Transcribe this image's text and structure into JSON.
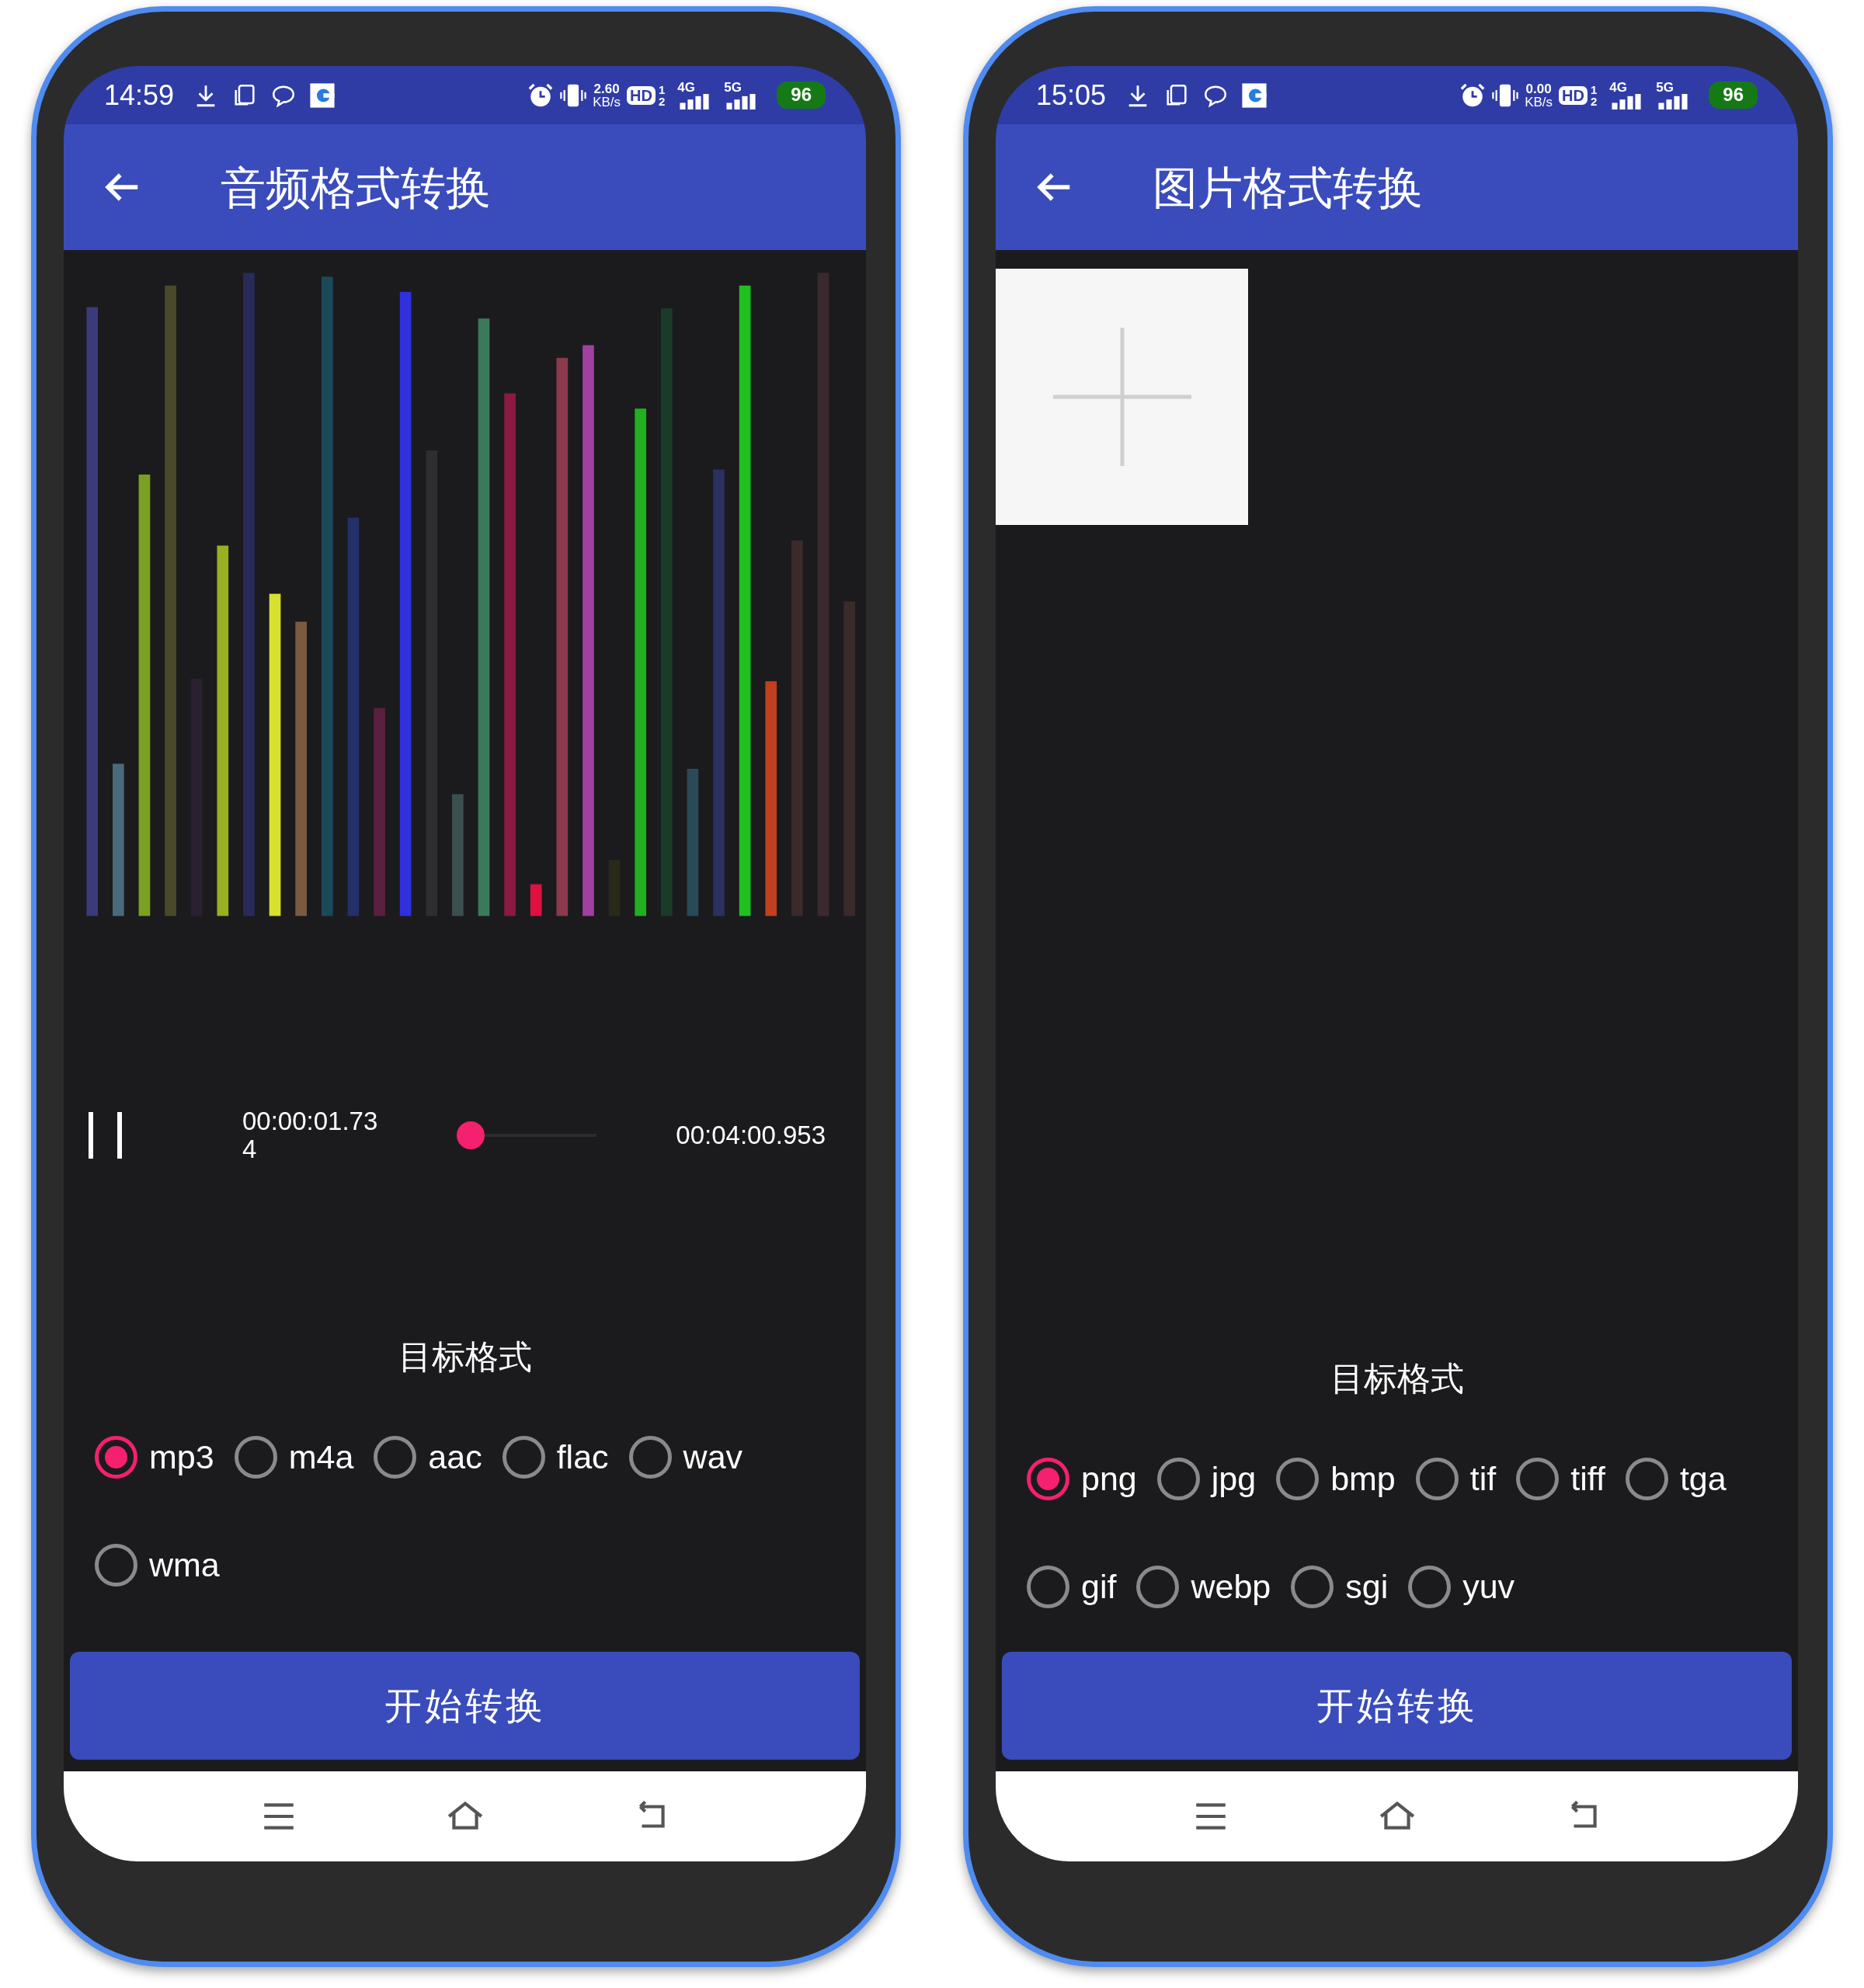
{
  "screens": [
    {
      "status_bar": {
        "time": "14:59",
        "speed_value": "2.60",
        "speed_unit": "KB/s",
        "hd_label": "HD",
        "sim_slots": [
          "1",
          "2"
        ],
        "networks": [
          "4G",
          "5G"
        ],
        "battery": "96"
      },
      "app_bar": {
        "title": "音频格式转换"
      },
      "content": {
        "kind": "audio",
        "player": {
          "playing": true,
          "elapsed": "00:00:01.734",
          "level": 0,
          "duration": "00:04:00.953"
        }
      },
      "format_label": "目标格式",
      "formats": [
        {
          "label": "mp3",
          "selected": true
        },
        {
          "label": "m4a",
          "selected": false
        },
        {
          "label": "aac",
          "selected": false
        },
        {
          "label": "flac",
          "selected": false
        },
        {
          "label": "wav",
          "selected": false
        },
        {
          "label": "wma",
          "selected": false
        }
      ],
      "convert_button": "开始转换"
    },
    {
      "status_bar": {
        "time": "15:05",
        "speed_value": "0.00",
        "speed_unit": "KB/s",
        "hd_label": "HD",
        "sim_slots": [
          "1",
          "2"
        ],
        "networks": [
          "4G",
          "5G"
        ],
        "battery": "96"
      },
      "app_bar": {
        "title": "图片格式转换"
      },
      "content": {
        "kind": "image"
      },
      "format_label": "目标格式",
      "formats": [
        {
          "label": "png",
          "selected": true
        },
        {
          "label": "jpg",
          "selected": false
        },
        {
          "label": "bmp",
          "selected": false
        },
        {
          "label": "tif",
          "selected": false
        },
        {
          "label": "tiff",
          "selected": false
        },
        {
          "label": "tga",
          "selected": false
        },
        {
          "label": "gif",
          "selected": false
        },
        {
          "label": "webp",
          "selected": false
        },
        {
          "label": "sgi",
          "selected": false
        },
        {
          "label": "yuv",
          "selected": false
        }
      ],
      "convert_button": "开始转换"
    }
  ]
}
